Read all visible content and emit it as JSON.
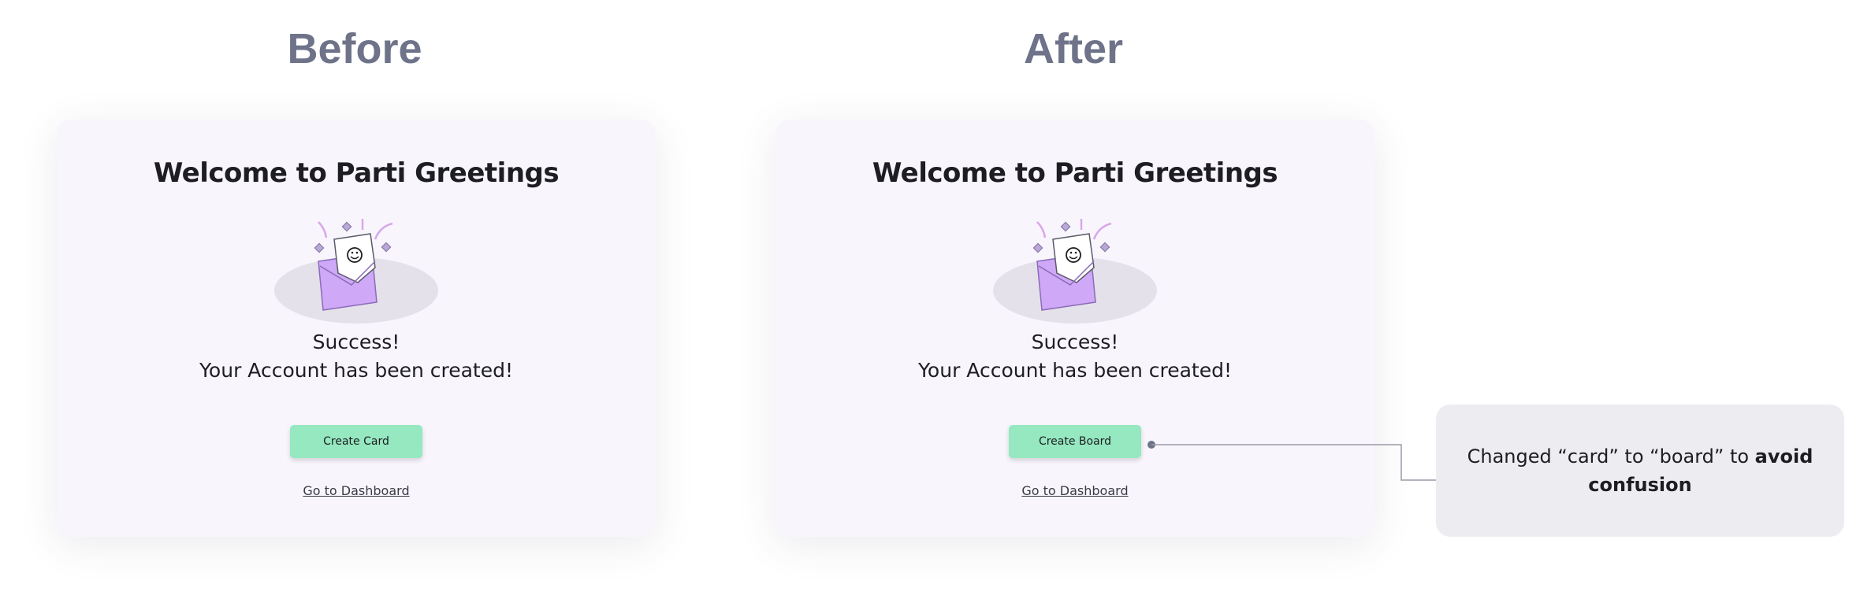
{
  "headings": {
    "before": "Before",
    "after": "After"
  },
  "before_card": {
    "title": "Welcome to Parti Greetings",
    "success_line": "Success!",
    "account_line": "Your Account has been created!",
    "primary_button": "Create Card",
    "dashboard_link": "Go to Dashboard"
  },
  "after_card": {
    "title": "Welcome to Parti Greetings",
    "success_line": "Success!",
    "account_line": "Your Account has been created!",
    "primary_button": "Create Board",
    "dashboard_link": "Go to Dashboard"
  },
  "annotation": {
    "text_plain": "Changed “card” to “board” to ",
    "text_bold": "avoid confusion"
  },
  "illustration": {
    "icon": "envelope-with-smiley-card-icon",
    "envelope_color": "#cfa8f7",
    "backdrop_color": "#e4e1ea",
    "confetti_color": "#d9a7ea"
  },
  "colors": {
    "heading": "#6e7389",
    "card_bg": "#f8f6fc",
    "button_bg": "#95e8bf",
    "callout_bg": "#ededf1",
    "connector": "#9a9aa8"
  }
}
